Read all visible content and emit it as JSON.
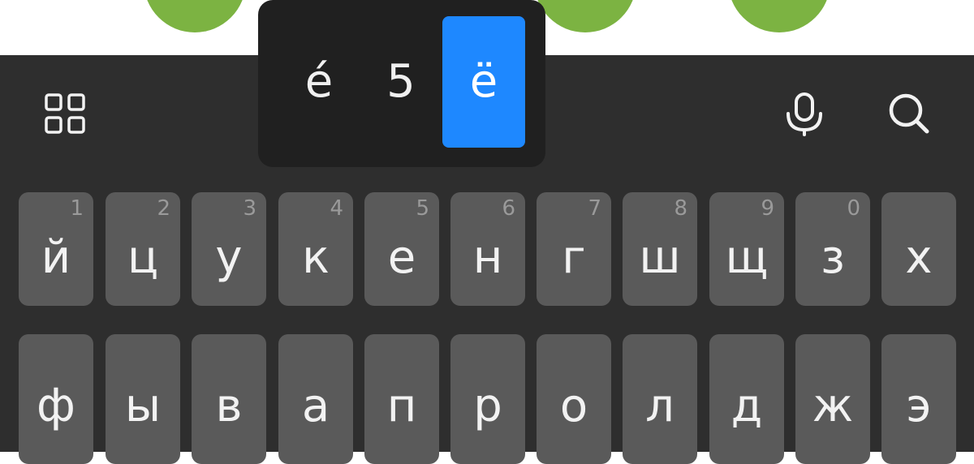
{
  "colors": {
    "accent_green": "#7cb342",
    "keyboard_bg": "#2e2e2e",
    "key_bg": "#5a5a5a",
    "popup_bg": "#202020",
    "selected_blue": "#1e88ff"
  },
  "toolbar": {
    "left_icon": "grid-apps-icon",
    "mic_icon": "microphone-icon",
    "search_icon": "search-icon"
  },
  "popup": {
    "options": [
      "é",
      "5",
      "ё"
    ],
    "selected_index": 2
  },
  "rows": [
    {
      "keys": [
        {
          "char": "й",
          "hint": "1"
        },
        {
          "char": "ц",
          "hint": "2"
        },
        {
          "char": "у",
          "hint": "3"
        },
        {
          "char": "к",
          "hint": "4"
        },
        {
          "char": "е",
          "hint": "5"
        },
        {
          "char": "н",
          "hint": "6"
        },
        {
          "char": "г",
          "hint": "7"
        },
        {
          "char": "ш",
          "hint": "8"
        },
        {
          "char": "щ",
          "hint": "9"
        },
        {
          "char": "з",
          "hint": "0"
        },
        {
          "char": "х",
          "hint": ""
        }
      ]
    },
    {
      "keys": [
        {
          "char": "ф",
          "hint": ""
        },
        {
          "char": "ы",
          "hint": ""
        },
        {
          "char": "в",
          "hint": ""
        },
        {
          "char": "а",
          "hint": ""
        },
        {
          "char": "п",
          "hint": ""
        },
        {
          "char": "р",
          "hint": ""
        },
        {
          "char": "о",
          "hint": ""
        },
        {
          "char": "л",
          "hint": ""
        },
        {
          "char": "д",
          "hint": ""
        },
        {
          "char": "ж",
          "hint": ""
        },
        {
          "char": "э",
          "hint": ""
        }
      ]
    }
  ]
}
